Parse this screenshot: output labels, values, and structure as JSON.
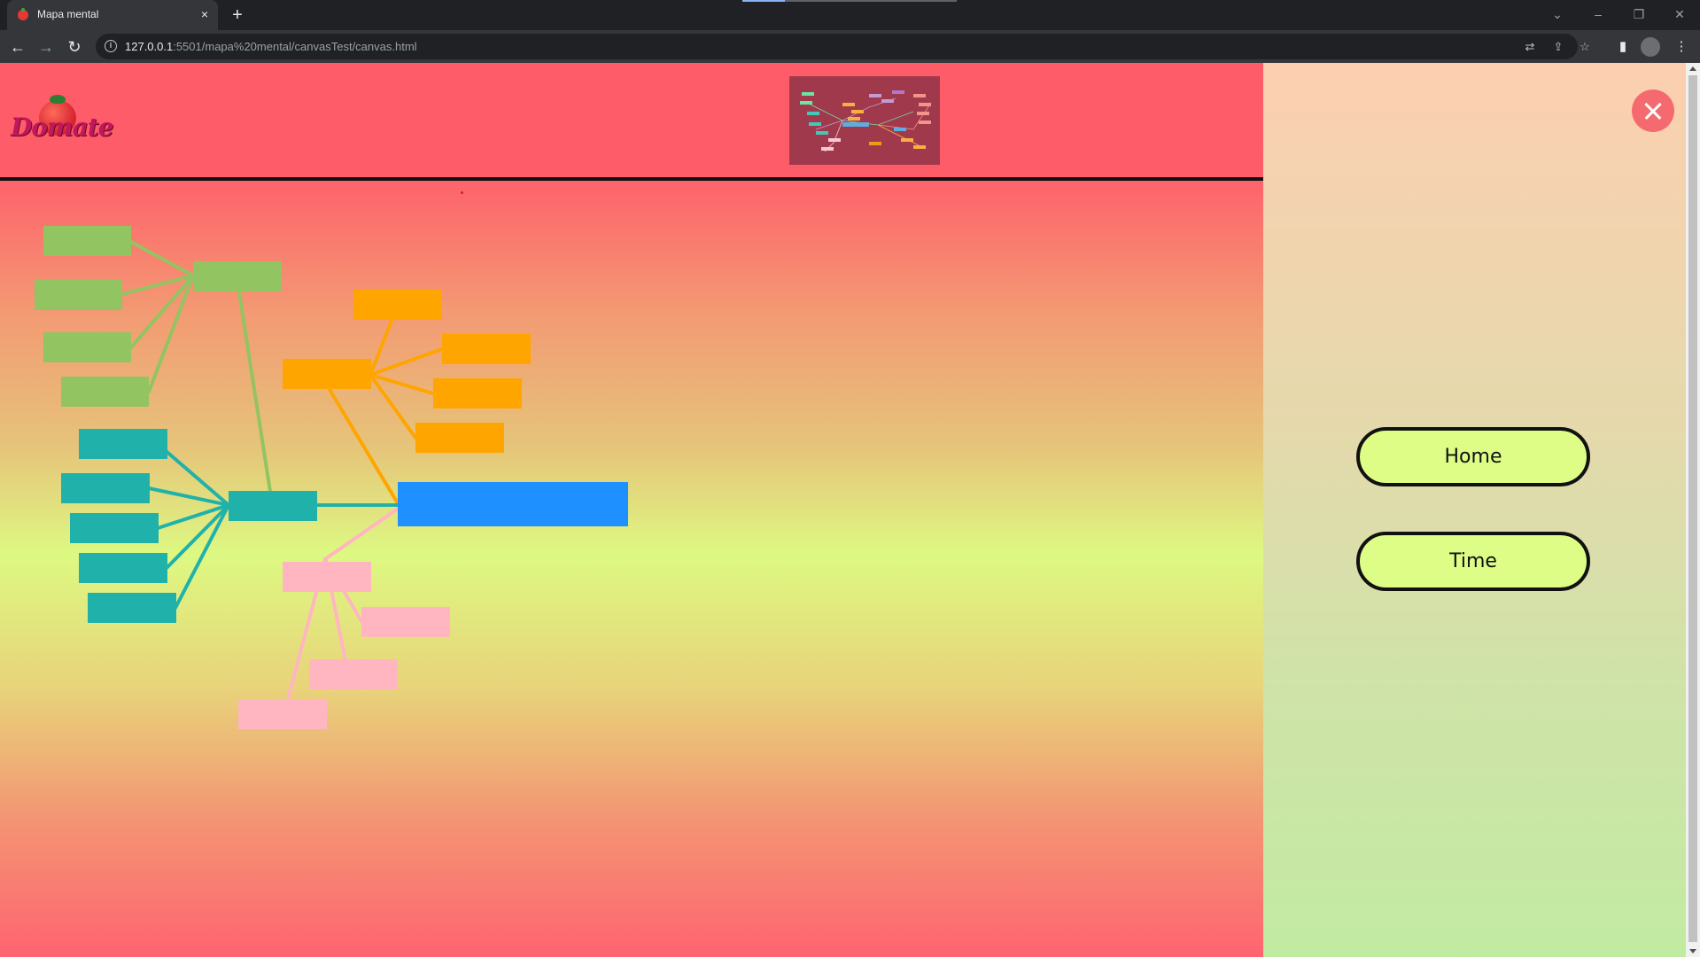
{
  "browser": {
    "tab_title": "Mapa mental",
    "tab_close": "×",
    "new_tab": "+",
    "url_host": "127.0.0.1",
    "url_path": ":5501/mapa%20mental/canvasTest/canvas.html",
    "controls": {
      "minimize": "–",
      "restore": "❐",
      "close": "✕",
      "tab_search": "⌄"
    },
    "nav": {
      "back": "←",
      "forward": "→",
      "reload": "↻"
    }
  },
  "page": {
    "logo_text": "Domate",
    "side_panel": {
      "home_label": "Home",
      "time_label": "Time"
    }
  },
  "colors": {
    "header": "#ff5c69",
    "green": "#93c462",
    "orange": "#ffa500",
    "teal": "#20b2aa",
    "blue": "#1e90ff",
    "pink": "#ffb6c1",
    "button_fill": "#ddfd86"
  },
  "icons": {
    "back": "back-arrow-icon",
    "forward": "forward-arrow-icon",
    "reload": "reload-icon",
    "info": "info-icon",
    "translate": "translate-icon",
    "share": "share-icon",
    "bookmark": "star-icon",
    "sidepanel": "side-panel-icon",
    "menu": "kebab-menu-icon",
    "close": "close-icon"
  }
}
